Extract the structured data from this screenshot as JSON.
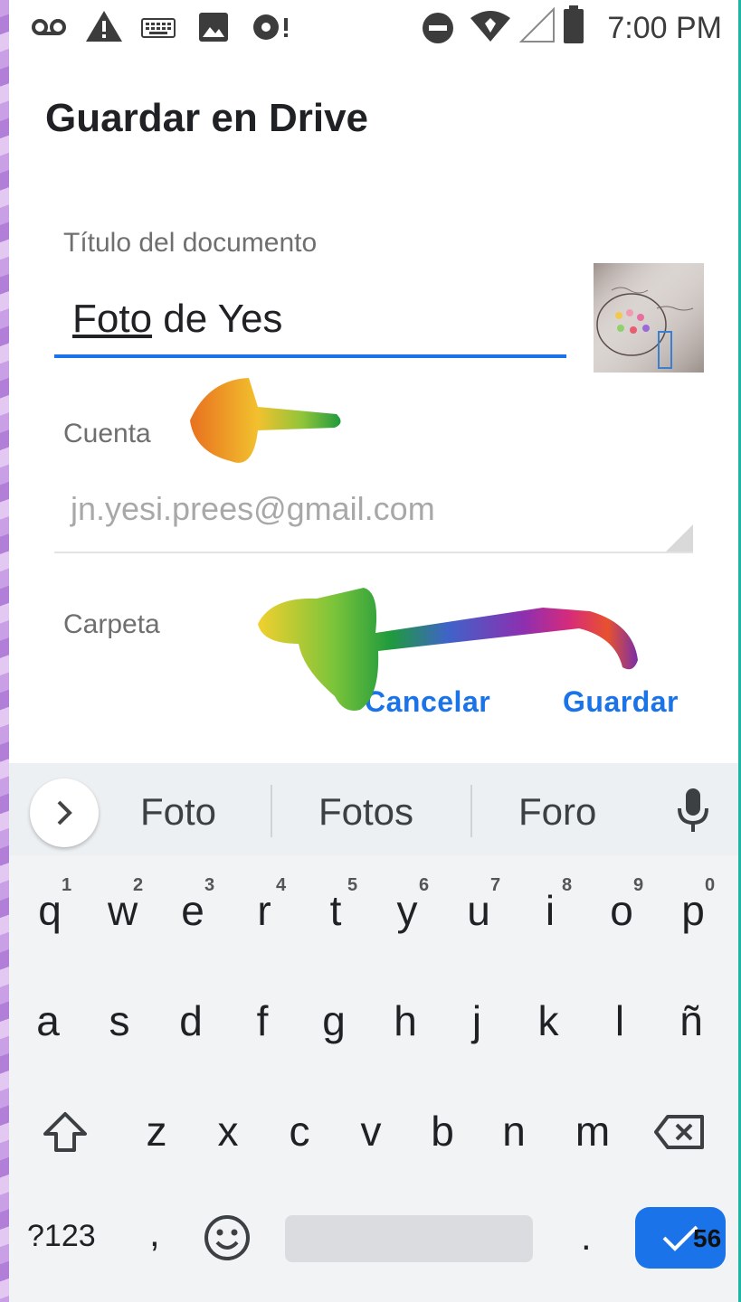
{
  "status_bar": {
    "time": "7:00 PM",
    "left_icons": [
      "voicemail-icon",
      "warning-icon",
      "keyboard-icon",
      "image-icon",
      "sync-alert-icon"
    ],
    "right_icons": [
      "do-not-disturb-icon",
      "wifi-icon",
      "signal-icon",
      "battery-icon"
    ]
  },
  "dialog": {
    "title": "Guardar en Drive",
    "title_field": {
      "label": "Título del documento",
      "value_underlined": "Foto",
      "value_rest": " de Yes"
    },
    "account_field": {
      "label": "Cuenta",
      "value": "jn.yesi.prees@gmail.com"
    },
    "folder_field": {
      "label": "Carpeta"
    },
    "buttons": {
      "cancel": "Cancelar",
      "save": "Guardar"
    }
  },
  "keyboard": {
    "suggestions": [
      "Foto",
      "Fotos",
      "Foro"
    ],
    "row1": [
      "q",
      "w",
      "e",
      "r",
      "t",
      "y",
      "u",
      "i",
      "o",
      "p"
    ],
    "row1_hints": [
      "1",
      "2",
      "3",
      "4",
      "5",
      "6",
      "7",
      "8",
      "9",
      "0"
    ],
    "row2": [
      "a",
      "s",
      "d",
      "f",
      "g",
      "h",
      "j",
      "k",
      "l",
      "ñ"
    ],
    "row3": [
      "z",
      "x",
      "c",
      "v",
      "b",
      "n",
      "m"
    ],
    "symbols_key": "?123",
    "comma_key": ",",
    "period_key": ".",
    "enter_badge": "56"
  },
  "colors": {
    "accent": "#1a73e8",
    "border_left": "#b27fd8",
    "border_right": "#1fb5a4"
  }
}
